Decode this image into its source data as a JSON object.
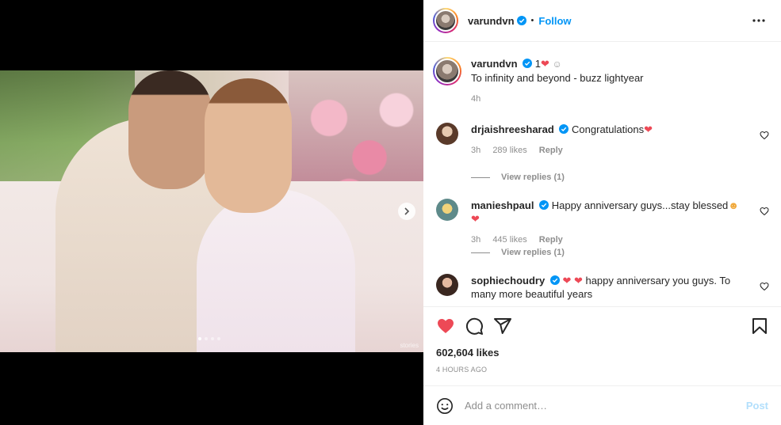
{
  "colors": {
    "accent": "#0095f6",
    "heart": "#ed4956",
    "muted": "#8e8e8e",
    "post_disabled": "#b2dffc"
  },
  "header": {
    "username": "varundvn",
    "follow_label": "Follow",
    "separator": "•"
  },
  "caption": {
    "username": "varundvn",
    "badge_text": "1",
    "text": "To infinity and beyond - buzz lightyear",
    "time": "4h"
  },
  "comments": [
    {
      "username": "drjaishreesharad",
      "text": "Congratulations",
      "time": "3h",
      "likes": "289 likes",
      "reply": "Reply",
      "view_replies": "View replies (1)"
    },
    {
      "username": "manieshpaul",
      "text": "Happy anniversary guys...stay blessed",
      "time": "3h",
      "likes": "445 likes",
      "reply": "Reply",
      "view_replies": "View replies (1)"
    },
    {
      "username": "sophiechoudry",
      "text": "happy anniversary you guys. To many more beautiful years"
    }
  ],
  "post": {
    "likes": "602,604 likes",
    "time_ago": "4 HOURS AGO"
  },
  "add_comment": {
    "placeholder": "Add a comment…",
    "post_label": "Post"
  },
  "photo": {
    "watermark": "stories"
  },
  "carousel": {
    "slide_count": 4,
    "active_slide": 1
  },
  "icons": [
    "more-options-icon",
    "verified-icon",
    "heart-icon",
    "comment-icon",
    "share-icon",
    "save-icon",
    "emoji-icon",
    "next-arrow-icon"
  ]
}
